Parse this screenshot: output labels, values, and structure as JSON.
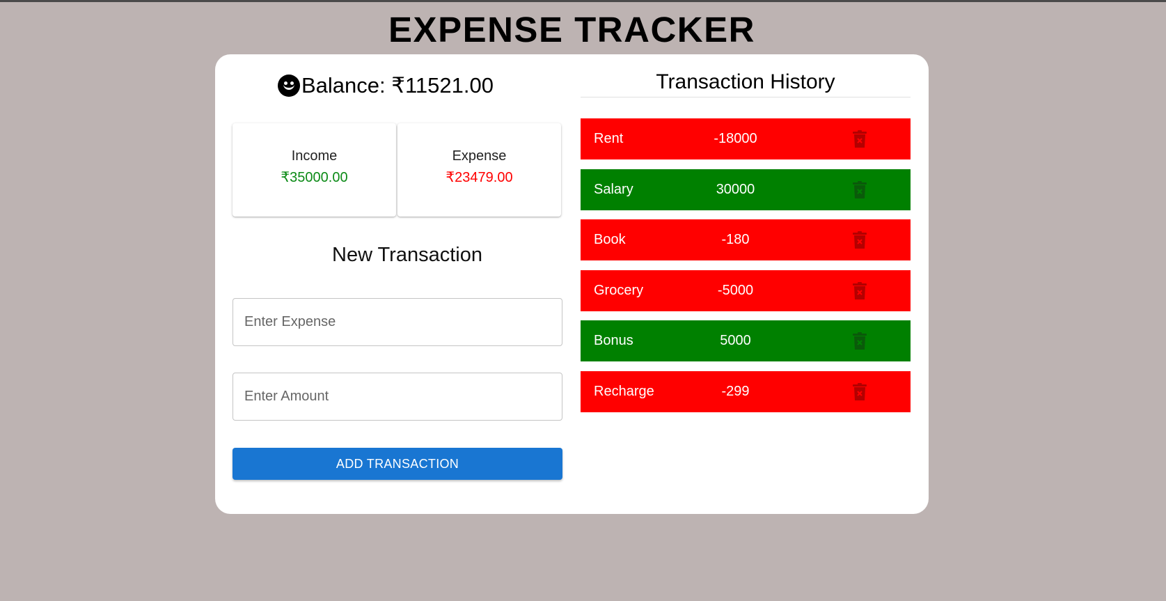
{
  "app": {
    "title": "EXPENSE TRACKER"
  },
  "balance": {
    "label": "Balance: ₹11521.00",
    "icon": "smile-icon"
  },
  "summary": {
    "income_label": "Income",
    "income_value": "₹35000.00",
    "expense_label": "Expense",
    "expense_value": "₹23479.00",
    "income_color": "#0b8a16",
    "expense_color": "#ff0000"
  },
  "new_transaction": {
    "title": "New Transaction",
    "expense_placeholder": "Enter Expense",
    "amount_placeholder": "Enter Amount",
    "submit_label": "ADD TRANSACTION"
  },
  "history": {
    "title": "Transaction History",
    "items": [
      {
        "name": "Rent",
        "amount": "-18000",
        "type": "neg"
      },
      {
        "name": "Salary",
        "amount": "30000",
        "type": "pos"
      },
      {
        "name": "Book",
        "amount": "-180",
        "type": "neg"
      },
      {
        "name": "Grocery",
        "amount": "-5000",
        "type": "neg"
      },
      {
        "name": "Bonus",
        "amount": "5000",
        "type": "pos"
      },
      {
        "name": "Recharge",
        "amount": "-299",
        "type": "neg"
      }
    ],
    "colors": {
      "neg": "#ff0000",
      "pos": "#008000"
    },
    "delete_icon": "trash-icon"
  }
}
